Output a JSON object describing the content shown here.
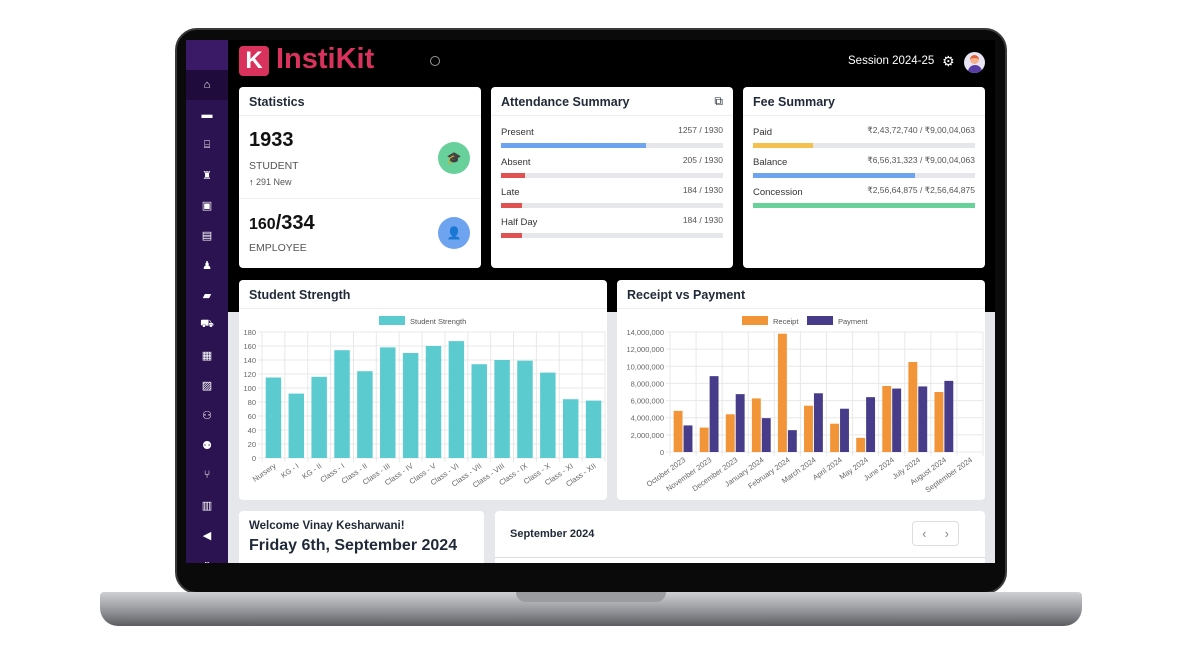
{
  "app": {
    "name": "InstiKit",
    "logo_letter": "K",
    "session": "Session 2024-25",
    "settings_icon": "gear-icon",
    "avatar_icon": "user-avatar"
  },
  "sidebar": {
    "items": [
      {
        "icon": "home-icon",
        "glyph": "⌂"
      },
      {
        "icon": "sofa-icon",
        "glyph": "▬"
      },
      {
        "icon": "bank-icon",
        "glyph": "⌸"
      },
      {
        "icon": "graduate-icon",
        "glyph": "♜"
      },
      {
        "icon": "money-icon",
        "glyph": "▣"
      },
      {
        "icon": "book-icon",
        "glyph": "▤"
      },
      {
        "icon": "user-tie-icon",
        "glyph": "♟"
      },
      {
        "icon": "folder-icon",
        "glyph": "▰"
      },
      {
        "icon": "truck-icon",
        "glyph": "⛟"
      },
      {
        "icon": "calendar-icon",
        "glyph": "▦"
      },
      {
        "icon": "image-icon",
        "glyph": "▨"
      },
      {
        "icon": "users-icon",
        "glyph": "⚇"
      },
      {
        "icon": "group-icon",
        "glyph": "⚉"
      },
      {
        "icon": "utensils-icon",
        "glyph": "⑂"
      },
      {
        "icon": "warehouse-icon",
        "glyph": "▥"
      },
      {
        "icon": "megaphone-icon",
        "glyph": "◀"
      },
      {
        "icon": "clipboard-icon",
        "glyph": "▯"
      }
    ]
  },
  "statistics": {
    "title": "Statistics",
    "student_count": "1933",
    "student_label": "STUDENT",
    "new_count": "291 New",
    "employee_count_present": "160",
    "employee_count_total": "/334",
    "employee_label": "EMPLOYEE",
    "colors": {
      "student": "#68d09b",
      "employee": "#6ea3ef"
    }
  },
  "attendance": {
    "title": "Attendance Summary",
    "items": [
      {
        "label": "Present",
        "value": "1257 / 1930",
        "fraction": 0.651,
        "color": "#6ea3ef"
      },
      {
        "label": "Absent",
        "value": "205 / 1930",
        "fraction": 0.106,
        "color": "#e05252"
      },
      {
        "label": "Late",
        "value": "184 / 1930",
        "fraction": 0.095,
        "color": "#e05252"
      },
      {
        "label": "Half Day",
        "value": "184 / 1930",
        "fraction": 0.095,
        "color": "#e05252"
      }
    ]
  },
  "fee": {
    "title": "Fee Summary",
    "items": [
      {
        "label": "Paid",
        "value": "₹2,43,72,740 / ₹9,00,04,063",
        "fraction": 0.271,
        "color": "#f4c04e"
      },
      {
        "label": "Balance",
        "value": "₹6,56,31,323 / ₹9,00,04,063",
        "fraction": 0.729,
        "color": "#6ea3ef"
      },
      {
        "label": "Concession",
        "value": "₹2,56,64,875 / ₹2,56,64,875",
        "fraction": 1.0,
        "color": "#68d09b"
      }
    ]
  },
  "chart_data": [
    {
      "type": "bar",
      "title": "Student Strength",
      "legend": [
        "Student Strength"
      ],
      "categories": [
        "Nursery",
        "KG - I",
        "KG - II",
        "Class - I",
        "Class - II",
        "Class - III",
        "Class - IV",
        "Class - V",
        "Class - VI",
        "Class - VII",
        "Class - VIII",
        "Class - IX",
        "Class - X",
        "Class - XI",
        "Class - XII"
      ],
      "series": [
        {
          "name": "Student Strength",
          "values": [
            115,
            92,
            116,
            154,
            124,
            158,
            150,
            160,
            167,
            134,
            140,
            139,
            122,
            84,
            82
          ],
          "color": "#5ccbd0"
        }
      ],
      "ylim": [
        0,
        180
      ],
      "yticks": [
        0,
        20,
        40,
        60,
        80,
        100,
        120,
        140,
        160,
        180
      ],
      "grid": true,
      "legend_position": "top"
    },
    {
      "type": "bar",
      "title": "Receipt vs Payment",
      "categories": [
        "October 2023",
        "November 2023",
        "December 2023",
        "January 2024",
        "February 2024",
        "March 2024",
        "April 2024",
        "May 2024",
        "June 2024",
        "July 2024",
        "August 2024",
        "September 2024"
      ],
      "series": [
        {
          "name": "Receipt",
          "values": [
            4800000,
            2850000,
            4400000,
            6250000,
            13800000,
            5400000,
            3300000,
            1650000,
            7700000,
            10500000,
            7000000,
            0
          ],
          "color": "#f29438"
        },
        {
          "name": "Payment",
          "values": [
            3100000,
            8850000,
            6750000,
            3950000,
            2550000,
            6850000,
            5050000,
            6400000,
            7400000,
            7650000,
            8300000,
            0
          ],
          "color": "#463c8a"
        }
      ],
      "ylim": [
        0,
        14000000
      ],
      "yticks": [
        "0",
        "2,000,000",
        "4,000,000",
        "6,000,000",
        "8,000,000",
        "10,000,000",
        "12,000,000",
        "14,000,000"
      ],
      "grid": true,
      "legend_position": "top"
    }
  ],
  "welcome": {
    "greeting": "Welcome Vinay Kesharwani!",
    "date": "Friday 6th, September 2024"
  },
  "calendar": {
    "month": "September 2024",
    "prev": "‹",
    "next": "›"
  }
}
